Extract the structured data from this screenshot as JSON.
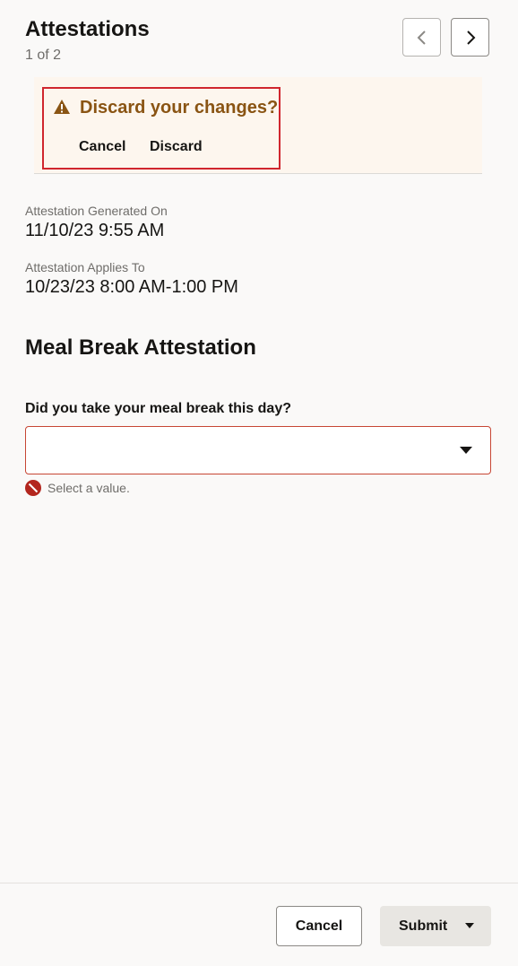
{
  "header": {
    "title": "Attestations",
    "subtitle": "1 of 2",
    "prev_icon": "chevron-left-icon",
    "next_icon": "chevron-right-icon"
  },
  "banner": {
    "icon": "warning-icon",
    "title": "Discard your changes?",
    "cancel_label": "Cancel",
    "discard_label": "Discard",
    "border_color": "#d0262e",
    "title_color": "#8a5413"
  },
  "details": {
    "generated_label": "Attestation Generated On",
    "generated_value": "11/10/23 9:55 AM",
    "applies_label": "Attestation Applies To",
    "applies_value": "10/23/23 8:00 AM-1:00 PM"
  },
  "section": {
    "title": "Meal Break Attestation",
    "question": "Did you take your meal break this day?",
    "select_value": "",
    "error_icon": "error-icon",
    "error_text": "Select a value."
  },
  "footer": {
    "cancel_label": "Cancel",
    "submit_label": "Submit"
  }
}
